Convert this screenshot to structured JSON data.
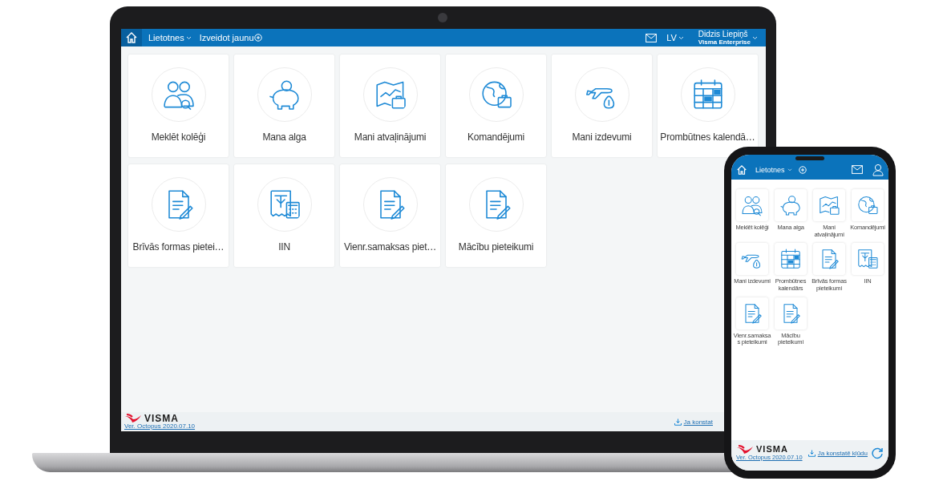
{
  "laptop": {
    "header": {
      "menu": "Lietotnes",
      "create": "Izveidot jaunu",
      "language": "LV",
      "user_name": "Didzis Liepiņš",
      "user_company": "Visma Enterprise"
    },
    "tiles": [
      {
        "label": "Meklēt kolēģi",
        "kind": "colleagues"
      },
      {
        "label": "Mana alga",
        "kind": "salary"
      },
      {
        "label": "Mani atvaļinājumi",
        "kind": "vacation"
      },
      {
        "label": "Komandējumi",
        "kind": "trips"
      },
      {
        "label": "Mani izdevumi",
        "kind": "expenses"
      },
      {
        "label": "Prombūtnes kalendā…",
        "kind": "calendar"
      },
      {
        "label": "Brīvās formas pietei…",
        "kind": "form"
      },
      {
        "label": "IIN",
        "kind": "tax"
      },
      {
        "label": "Vienr.samaksas piet…",
        "kind": "form"
      },
      {
        "label": "Mācību pieteikumi",
        "kind": "form"
      }
    ],
    "footer": {
      "logo": "VISMA",
      "version": "Ver. Octopus 2020.07.10",
      "report_link": "Ja konstat"
    }
  },
  "phone": {
    "header": {
      "menu": "Lietotnes"
    },
    "tiles": [
      {
        "label": "Meklēt kolēģi",
        "kind": "colleagues"
      },
      {
        "label": "Mana alga",
        "kind": "salary"
      },
      {
        "label": "Mani atvaļinājumi",
        "kind": "vacation"
      },
      {
        "label": "Komandējumi",
        "kind": "trips"
      },
      {
        "label": "Mani izdevumi",
        "kind": "expenses"
      },
      {
        "label": "Prombūtnes kalendārs",
        "kind": "calendar"
      },
      {
        "label": "Brīvās formas pieteikumi",
        "kind": "form"
      },
      {
        "label": "IIN",
        "kind": "tax"
      },
      {
        "label": "Vienr.samaksas pieteikumi",
        "kind": "form"
      },
      {
        "label": "Mācību pieteikumi",
        "kind": "form"
      }
    ],
    "footer": {
      "logo": "VISMA",
      "version": "Ver. Octopus 2020.07.10",
      "report_link": "Ja konstatē kļūdu"
    }
  }
}
